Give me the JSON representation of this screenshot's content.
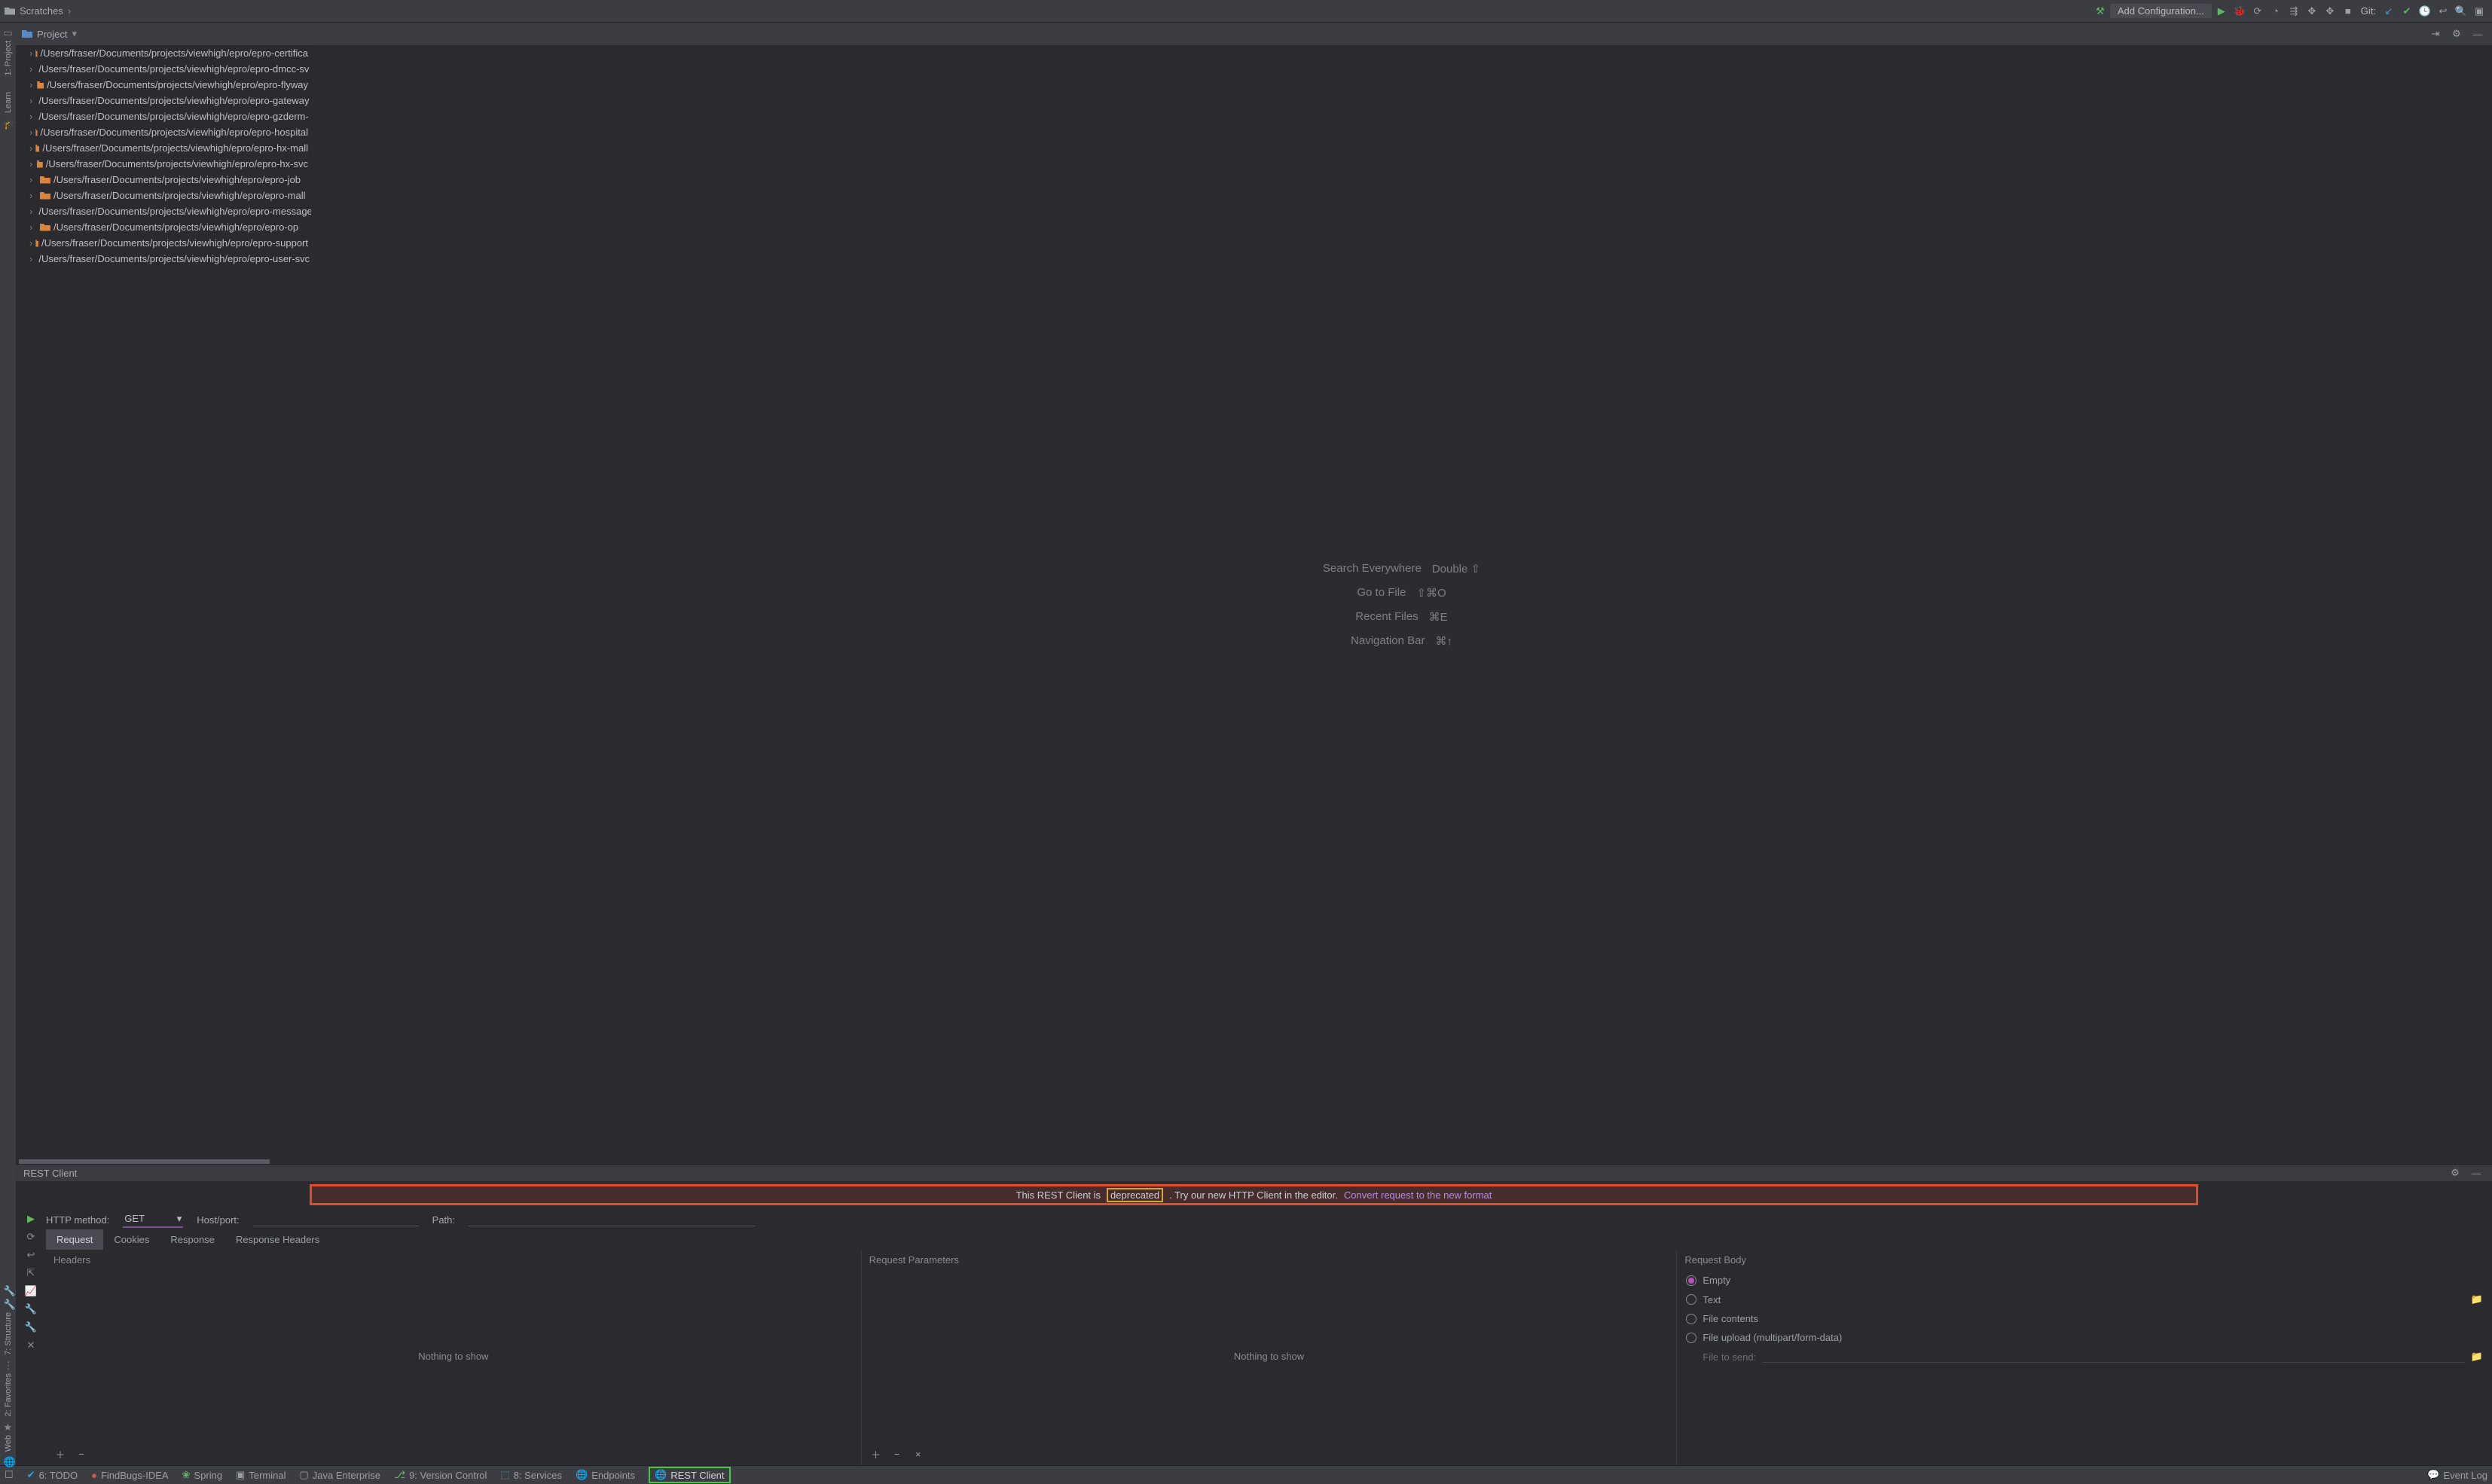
{
  "breadcrumb": {
    "item": "Scratches"
  },
  "toolbar": {
    "add_config": "Add Configuration...",
    "git_label": "Git:"
  },
  "left_gutter": {
    "project": "1: Project",
    "learn": "Learn",
    "structure": "7: Structure",
    "favorites": "2: Favorites",
    "web": "Web"
  },
  "project_pane": {
    "title": "Project",
    "items": [
      "/Users/fraser/Documents/projects/viewhigh/epro/epro-certifica",
      "/Users/fraser/Documents/projects/viewhigh/epro/epro-dmcc-sv",
      "/Users/fraser/Documents/projects/viewhigh/epro/epro-flyway",
      "/Users/fraser/Documents/projects/viewhigh/epro/epro-gateway",
      "/Users/fraser/Documents/projects/viewhigh/epro/epro-gzderm-",
      "/Users/fraser/Documents/projects/viewhigh/epro/epro-hospital",
      "/Users/fraser/Documents/projects/viewhigh/epro/epro-hx-mall",
      "/Users/fraser/Documents/projects/viewhigh/epro/epro-hx-svc",
      "/Users/fraser/Documents/projects/viewhigh/epro/epro-job",
      "/Users/fraser/Documents/projects/viewhigh/epro/epro-mall",
      "/Users/fraser/Documents/projects/viewhigh/epro/epro-message",
      "/Users/fraser/Documents/projects/viewhigh/epro/epro-op",
      "/Users/fraser/Documents/projects/viewhigh/epro/epro-support",
      "/Users/fraser/Documents/projects/viewhigh/epro/epro-user-svc"
    ]
  },
  "editor_hints": {
    "search_label": "Search Everywhere",
    "search_key": "Double ⇧",
    "goto_label": "Go to File",
    "goto_key": "⇧⌘O",
    "recent_label": "Recent Files",
    "recent_key": "⌘E",
    "nav_label": "Navigation Bar",
    "nav_key": "⌘↑"
  },
  "rest": {
    "title": "REST Client",
    "deprecated_msg_pre": "This REST Client is",
    "deprecated_word": "deprecated",
    "deprecated_msg_post": ". Try our new HTTP Client in the editor.",
    "convert_link": "Convert request to the new format",
    "method_label": "HTTP method:",
    "method_value": "GET",
    "host_label": "Host/port:",
    "path_label": "Path:",
    "tabs": {
      "request": "Request",
      "cookies": "Cookies",
      "response": "Response",
      "response_headers": "Response Headers"
    },
    "cols": {
      "headers": "Headers",
      "params": "Request Parameters",
      "body": "Request Body"
    },
    "nothing": "Nothing to show",
    "body_opts": {
      "empty": "Empty",
      "text": "Text",
      "file_contents": "File contents",
      "file_upload": "File upload (multipart/form-data)",
      "file_to_send": "File to send:"
    }
  },
  "bottom": {
    "todo": "6: TODO",
    "findbugs": "FindBugs-IDEA",
    "spring": "Spring",
    "terminal": "Terminal",
    "java_ee": "Java Enterprise",
    "vcs": "9: Version Control",
    "services": "8: Services",
    "endpoints": "Endpoints",
    "rest_client": "REST Client",
    "event_log": "Event Log"
  }
}
